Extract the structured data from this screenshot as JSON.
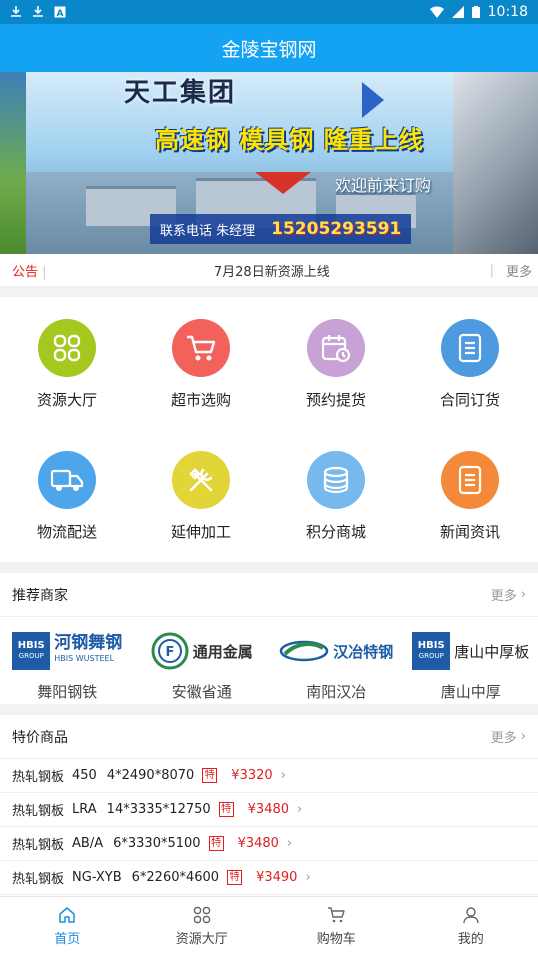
{
  "status_bar": {
    "time": "10:18"
  },
  "app_bar": {
    "title": "金陵宝钢网"
  },
  "banner": {
    "top_text": "天工集团",
    "headline": "高速钢 模具钢 隆重上线",
    "welcome": "欢迎前来订购",
    "contact_label": "联系电话 朱经理",
    "phone": "15205293591"
  },
  "notice": {
    "tag": "公告",
    "text": "7月28日新资源上线",
    "more": "更多"
  },
  "menu": [
    {
      "label": "资源大厅",
      "icon": "grid-icon",
      "color": "#a4c81e"
    },
    {
      "label": "超市选购",
      "icon": "cart-icon",
      "color": "#f2625a"
    },
    {
      "label": "预约提货",
      "icon": "calendar-clock-icon",
      "color": "#c8a2d6"
    },
    {
      "label": "合同订货",
      "icon": "document-icon",
      "color": "#4e9ae0"
    },
    {
      "label": "物流配送",
      "icon": "truck-icon",
      "color": "#4ea6ea"
    },
    {
      "label": "延伸加工",
      "icon": "tools-icon",
      "color": "#e1d538"
    },
    {
      "label": "积分商城",
      "icon": "coins-icon",
      "color": "#76b9ee"
    },
    {
      "label": "新闻资讯",
      "icon": "news-icon",
      "color": "#f38a3a"
    }
  ],
  "merchants": {
    "title": "推荐商家",
    "more": "更多",
    "items": [
      {
        "logo_text": "河钢舞钢",
        "logo_sub": "HBIS WUSTEEL",
        "name": "舞阳钢铁"
      },
      {
        "logo_text": "通用金属",
        "logo_sub": "",
        "name": "安徽省通"
      },
      {
        "logo_text": "汉冶特钢",
        "logo_sub": "",
        "name": "南阳汉冶"
      },
      {
        "logo_text": "唐山中厚板",
        "logo_sub": "",
        "name": "唐山中厚"
      }
    ]
  },
  "deals": {
    "title": "特价商品",
    "more": "更多",
    "items": [
      {
        "name": "热轧钢板",
        "grade": "450",
        "size": "4*2490*8070",
        "badge": "特",
        "price": "¥3320"
      },
      {
        "name": "热轧钢板",
        "grade": "LRA",
        "size": "14*3335*12750",
        "badge": "特",
        "price": "¥3480"
      },
      {
        "name": "热轧钢板",
        "grade": "AB/A",
        "size": "6*3330*5100",
        "badge": "特",
        "price": "¥3480"
      },
      {
        "name": "热轧钢板",
        "grade": "NG-XYB",
        "size": "6*2260*4600",
        "badge": "特",
        "price": "¥3490"
      }
    ]
  },
  "tabs": [
    {
      "label": "首页",
      "icon": "home-icon",
      "active": true
    },
    {
      "label": "资源大厅",
      "icon": "grid-icon",
      "active": false
    },
    {
      "label": "购物车",
      "icon": "cart-icon",
      "active": false
    },
    {
      "label": "我的",
      "icon": "person-icon",
      "active": false
    }
  ]
}
